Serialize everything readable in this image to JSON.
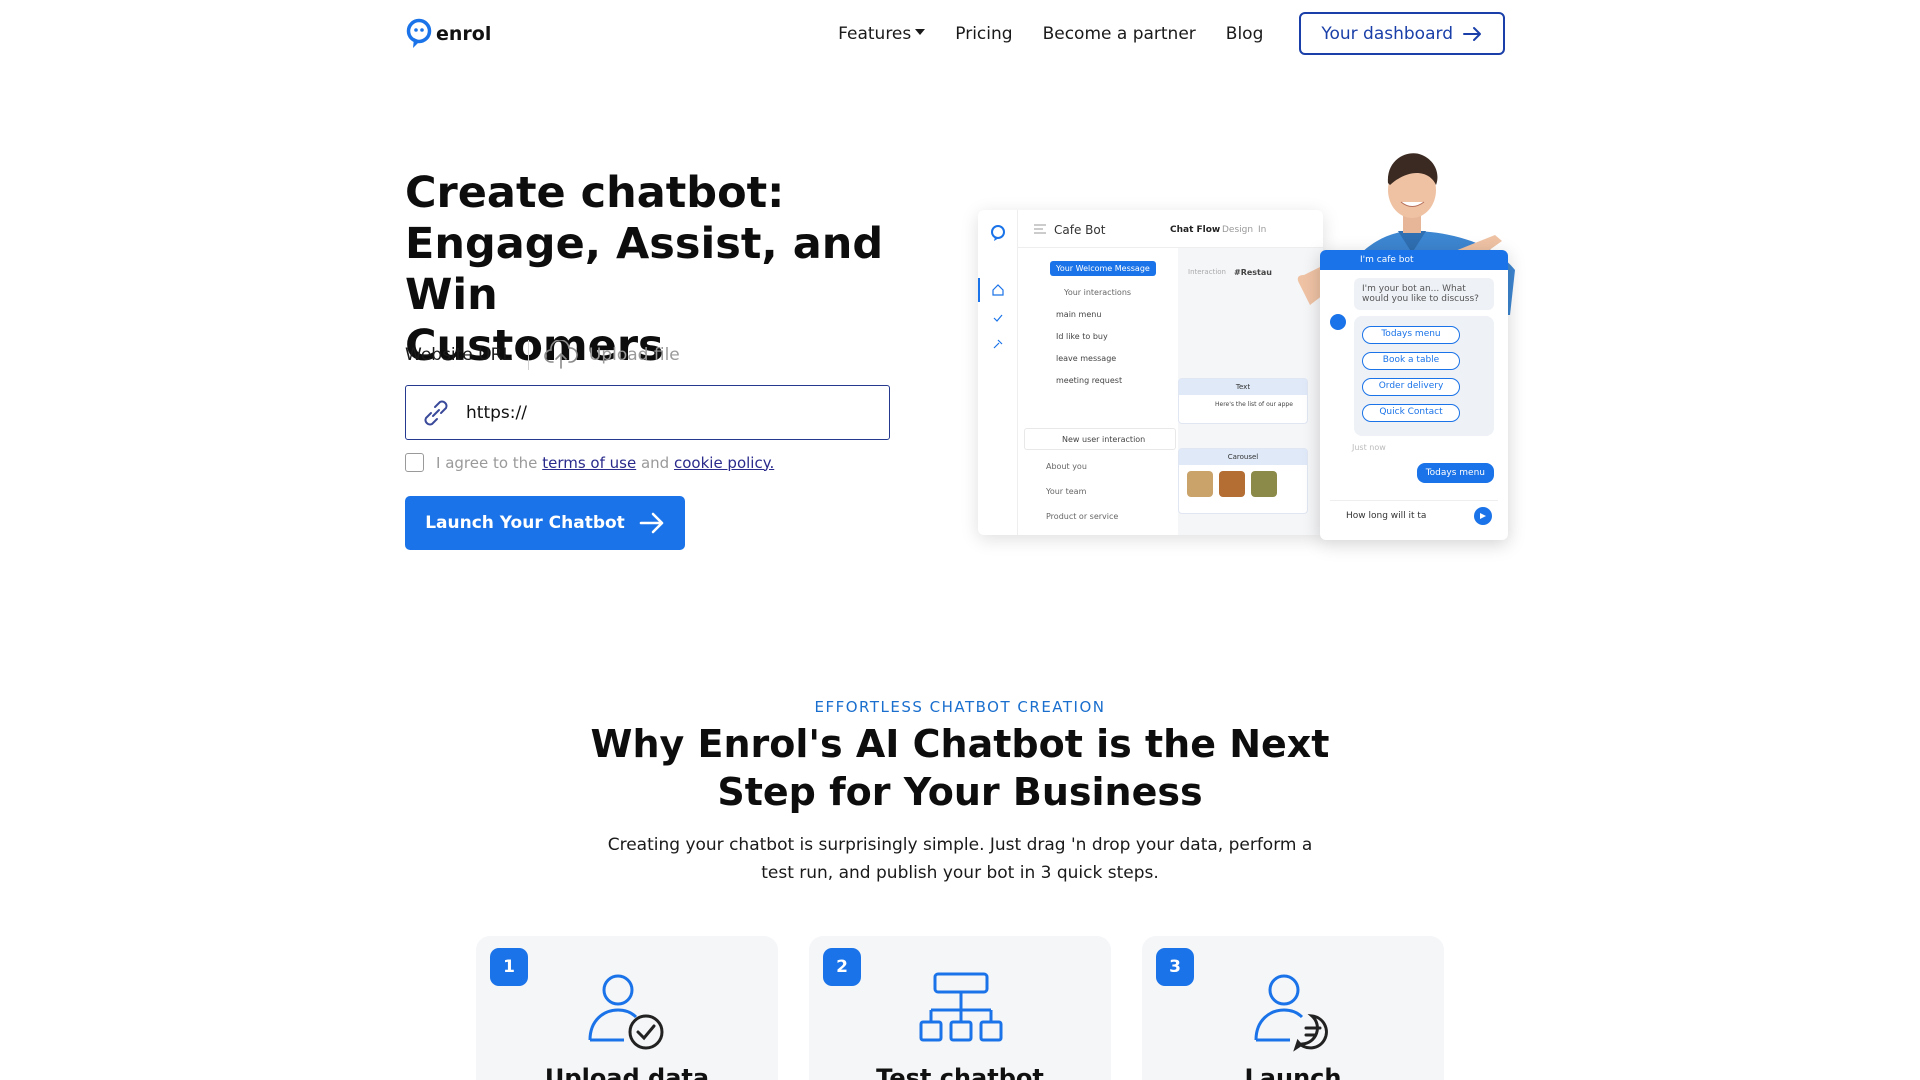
{
  "nav": {
    "logo_text": "enrol",
    "links": [
      {
        "label": "Features",
        "has_caret": true
      },
      {
        "label": "Pricing"
      },
      {
        "label": "Become a partner"
      },
      {
        "label": "Blog"
      }
    ],
    "dashboard_label": "Your dashboard"
  },
  "hero": {
    "title_lines": [
      "Create chatbot:",
      "Engage, Assist, and Win",
      "Customers"
    ],
    "tab_url": "Website URL",
    "tab_upload": "Upload file",
    "url_value": "https://",
    "agree_prefix": "I agree to the",
    "terms_link": "terms of use",
    "agree_and": "and",
    "cookie_link": "cookie policy.",
    "launch_label": "Launch Your Chatbot"
  },
  "mockup": {
    "bot_name": "Cafe Bot",
    "tabs": [
      "Chat Flow",
      "Design",
      "In"
    ],
    "welcome": "Your Welcome Message",
    "your_interactions": "Your interactions",
    "interactions": [
      "main menu",
      "Id like to buy",
      "leave message",
      "meeting request"
    ],
    "new_interaction": "New user interaction",
    "sections": [
      "About you",
      "Your team",
      "Product or service"
    ],
    "interaction_label": "Interaction",
    "interaction_name": "#Restau",
    "node_text_head": "Text",
    "node_text_body": "Here's the list of our appe",
    "node_carousel_head": "Carousel",
    "chat_header": "I'm cafe bot",
    "chat_bubble": "I'm your bot an... What would you like to discuss?",
    "chat_options": [
      "Todays menu",
      "Book a table",
      "Order delivery",
      "Quick Contact"
    ],
    "chat_time": "Just now",
    "chat_sent": "Todays menu",
    "chat_input": "How long will it ta"
  },
  "section": {
    "eyebrow": "EFFORTLESS CHATBOT CREATION",
    "title": "Why Enrol's AI Chatbot is the Next Step for Your Business",
    "subtitle": "Creating your chatbot is surprisingly simple. Just drag 'n drop your data, perform a test run, and publish your bot in 3 quick steps.",
    "cards": [
      {
        "num": "1",
        "title": "Upload data",
        "icon": "user-check-icon"
      },
      {
        "num": "2",
        "title": "Test chatbot",
        "icon": "sitemap-icon"
      },
      {
        "num": "3",
        "title": "Launch",
        "icon": "user-chat-icon"
      }
    ]
  },
  "colors": {
    "accent": "#1a73e8",
    "navy": "#1a3fa8",
    "card_bg": "#f5f6f8"
  }
}
